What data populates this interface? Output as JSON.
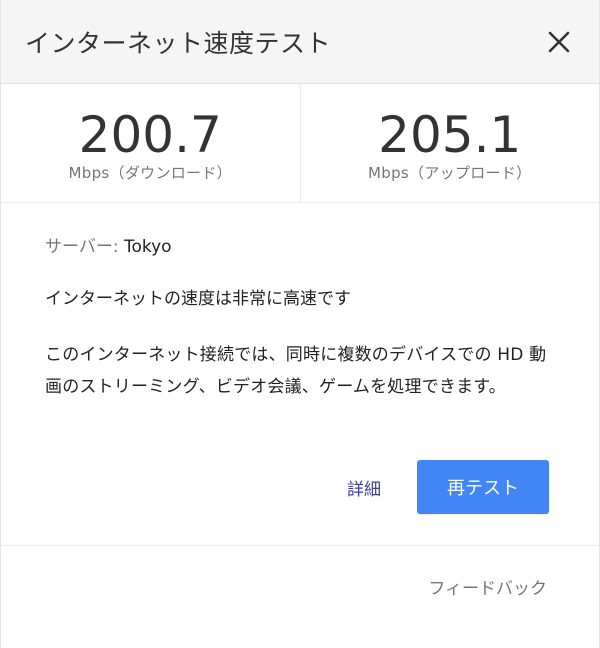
{
  "header": {
    "title": "インターネット速度テスト",
    "close_icon": "close-icon"
  },
  "results": {
    "download": {
      "value": "200.7",
      "unit": "Mbps（ダウンロード）"
    },
    "upload": {
      "value": "205.1",
      "unit": "Mbps（アップロード）"
    }
  },
  "info": {
    "server_label": "サーバー: ",
    "server_value": "Tokyo",
    "status": "インターネットの速度は非常に高速です",
    "description": "このインターネット接続では、同時に複数のデバイスでの HD 動画のストリーミング、ビデオ会議、ゲームを処理できます。"
  },
  "actions": {
    "details_label": "詳細",
    "retest_label": "再テスト"
  },
  "footer": {
    "feedback_label": "フィードバック"
  },
  "colors": {
    "primary": "#4285f4",
    "link": "#3b3e96",
    "header_bg": "#f5f5f5"
  }
}
